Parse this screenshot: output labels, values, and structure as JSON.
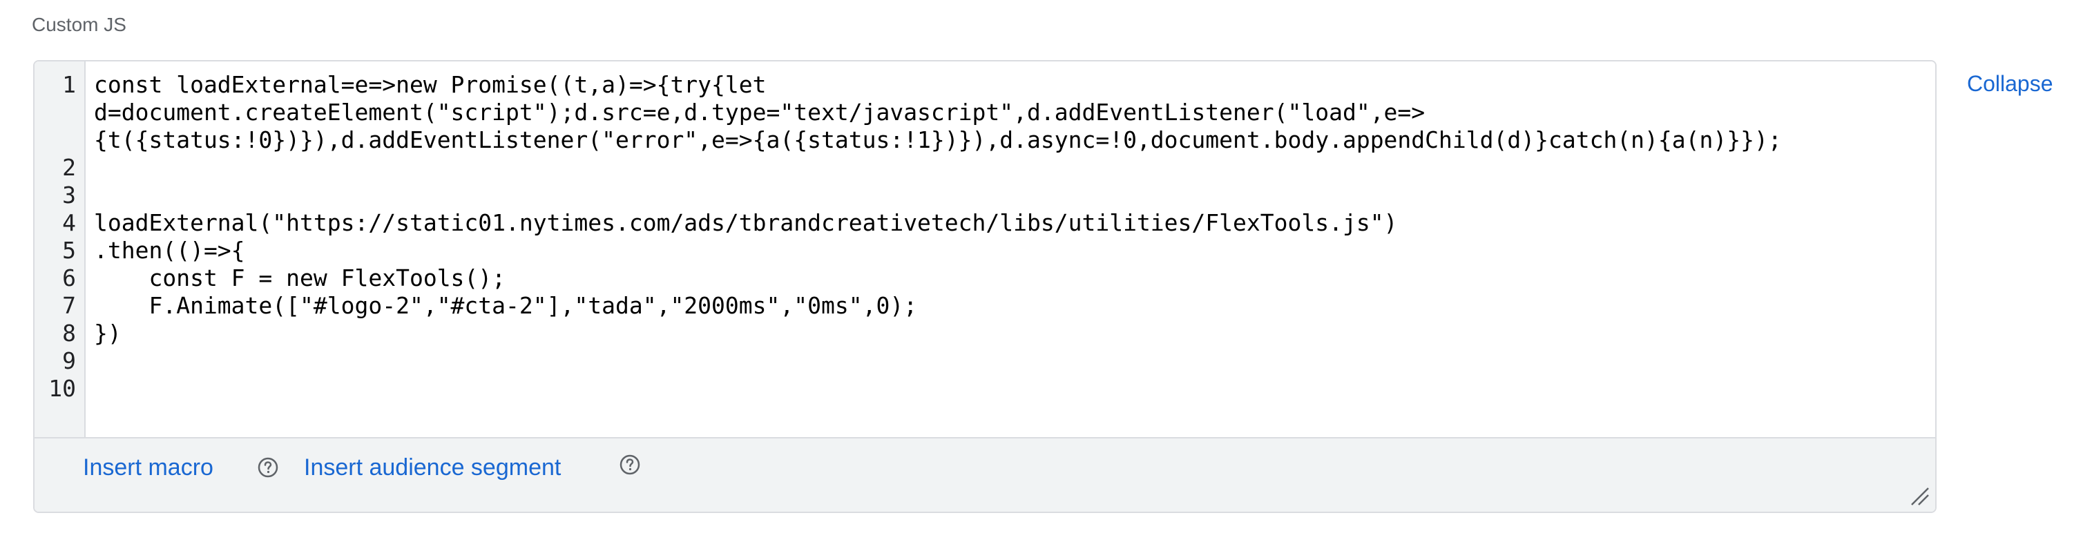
{
  "field": {
    "label": "Custom JS"
  },
  "editor": {
    "line_numbers": [
      "1",
      "2",
      "3",
      "4",
      "5",
      "6",
      "7",
      "8",
      "9",
      "10"
    ],
    "lines": [
      "const loadExternal=e=>new Promise((t,a)=>{try{let",
      "d=document.createElement(\"script\");d.src=e,d.type=\"text/javascript\",d.addEventListener(\"load\",e=>",
      "{t({status:!0})}),d.addEventListener(\"error\",e=>{a({status:!1})}),d.async=!0,document.body.appendChild(d)}catch(n){a(n)}});",
      "",
      "",
      "loadExternal(\"https://static01.nytimes.com/ads/tbrandcreativetech/libs/utilities/FlexTools.js\")",
      ".then(()=>{",
      "    const F = new FlexTools();",
      "    F.Animate([\"#logo-2\",\"#cta-2\"],\"tada\",\"2000ms\",\"0ms\",0);",
      "})",
      "",
      ""
    ]
  },
  "footer": {
    "insert_macro_label": "Insert macro",
    "insert_audience_segment_label": "Insert audience segment",
    "help_icon": "help-circle-icon",
    "resize_icon": "resize-handle-icon"
  },
  "actions": {
    "collapse_label": "Collapse"
  },
  "colors": {
    "link": "#1967d2",
    "border": "#dadce0",
    "gutter_bg": "#f1f3f4",
    "footer_bg": "#f1f3f4",
    "label": "#5f6368"
  }
}
